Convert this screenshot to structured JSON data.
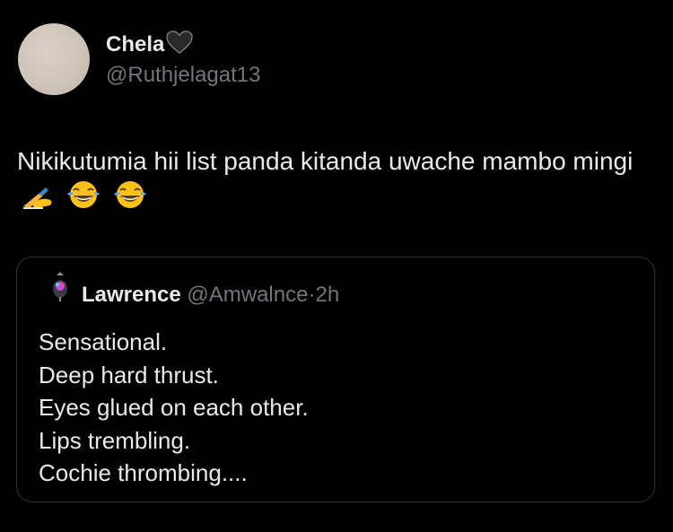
{
  "author": {
    "display_name": "Chela",
    "name_emoji": "black-heart-icon",
    "handle": "@Ruthjelagat13"
  },
  "tweet": {
    "text": "Nikikutumia hii list panda kitanda uwache mambo mingi",
    "emojis": [
      "writing-hand-icon",
      "tears-of-joy-icon",
      "tears-of-joy-icon"
    ]
  },
  "quoted_tweet": {
    "display_name": "Lawrence",
    "handle": "@Amwalnce",
    "separator": "·",
    "time": "2h",
    "lines": [
      "Sensational.",
      "Deep hard thrust.",
      "Eyes glued on each other.",
      "Lips trembling.",
      "Cochie thrombing...."
    ]
  },
  "colors": {
    "background": "#000000",
    "primary_text": "#e7e9ea",
    "secondary_text": "#71767b",
    "border": "#2f3336"
  }
}
